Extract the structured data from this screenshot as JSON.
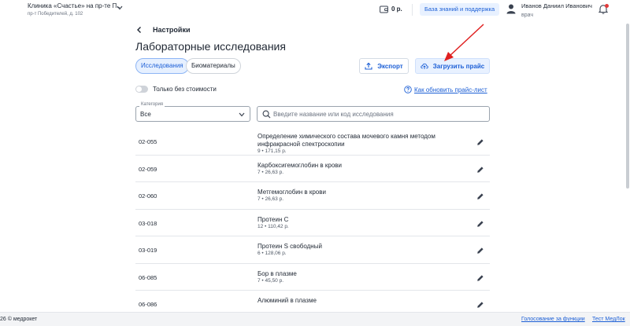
{
  "header": {
    "clinic_name": "Клиника «Счастье» на пр-те П...",
    "clinic_address": "пр-т Победителей, д. 102",
    "balance": "0 р.",
    "knowledge_base_label": "База знаний и поддержка",
    "user_name": "Иванов Даниил Иванович",
    "user_role": "врач"
  },
  "page": {
    "back_label": "Настройки",
    "title": "Лабораторные исследования"
  },
  "tabs": [
    {
      "label": "Исследования",
      "active": true
    },
    {
      "label": "Биоматериалы",
      "active": false
    }
  ],
  "actions": {
    "export_label": "Экспорт",
    "upload_label": "Загрузить прайс"
  },
  "filters": {
    "toggle_label": "Только без стоимости",
    "help_link": "Как обновить прайс-лист",
    "category_legend": "Категория",
    "category_value": "Все",
    "search_placeholder": "Введите название или код исследования"
  },
  "rows": [
    {
      "code": "02-055",
      "name": "Определение химического состава мочевого камня методом инфракрасной спектроскопии",
      "meta": "9 • 171,15 р."
    },
    {
      "code": "02-059",
      "name": "Карбоксигемоглобин в крови",
      "meta": "7 • 26,63 р."
    },
    {
      "code": "02-060",
      "name": "Метгемоглобин в крови",
      "meta": "7 • 26,63 р."
    },
    {
      "code": "03-018",
      "name": "Протеин С",
      "meta": "12 • 110,42 р."
    },
    {
      "code": "03-019",
      "name": "Протеин S свободный",
      "meta": "6 • 128,06 р."
    },
    {
      "code": "06-085",
      "name": "Бор в плазме",
      "meta": "7 • 45,50 р."
    },
    {
      "code": "06-086",
      "name": "Алюминий в плазме",
      "meta": ""
    }
  ],
  "footer": {
    "copyright": "26 © медрокет",
    "vote_link": "Голосование за функции",
    "test_link": "Тест МедЛок"
  },
  "colors": {
    "accent": "#1c5fd6",
    "accent_bg": "#e8f1ff",
    "annotation_arrow": "#e02020",
    "notification_dot": "#e23b3b"
  }
}
